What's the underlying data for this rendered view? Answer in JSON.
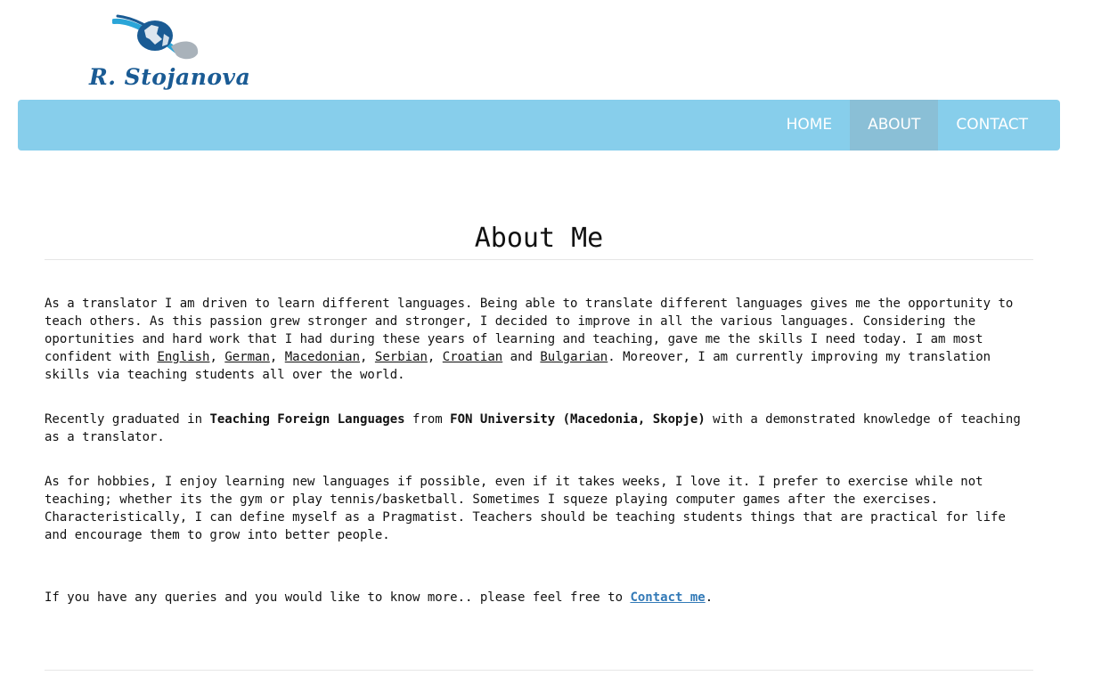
{
  "logo": {
    "text": "R. Stojanova",
    "icon": "globe-swoosh-icon"
  },
  "nav": {
    "items": [
      {
        "label": "HOME"
      },
      {
        "label": "ABOUT"
      },
      {
        "label": "CONTACT"
      }
    ],
    "active": "ABOUT"
  },
  "main": {
    "title": "About Me",
    "p1": {
      "text1": "As a translator I am driven to learn different languages. Being able to translate different languages gives me the opportunity to teach others. As this passion grew stronger and stronger, I decided to improve in all the various languages. Considering the oportunities and hard work that I had during these years of learning and teaching, gave me the skills I need today. I am most confident with ",
      "lang1": "English",
      "sep1": ", ",
      "lang2": "German",
      "sep2": ", ",
      "lang3": "Macedonian",
      "sep3": ", ",
      "lang4": "Serbian",
      "sep4": ", ",
      "lang5": "Croatian",
      "sep5": " and ",
      "lang6": "Bulgarian",
      "text2": ". Moreover, I am currently improving my translation skills via teaching students all over the world."
    },
    "p2": {
      "text1": "Recently graduated in ",
      "bold1": "Teaching Foreign Languages",
      "text2": " from ",
      "bold2": "FON University (Macedonia, Skopje)",
      "text3": " with a demonstrated knowledge of teaching as a translator."
    },
    "p3": {
      "text": "As for hobbies, I enjoy learning new languages if possible, even if it takes weeks, I love it. I prefer to exercise while not teaching; whether its the gym or play tennis/basketball. Sometimes I squeze playing computer games after the exercises. Characteristically, I can define myself as a Pragmatist. Teachers should be teaching students things that are practical for life and encourage them to grow into better people."
    },
    "p4": {
      "text1": "If you have any queries and you would like to know more.. please feel free to ",
      "link": "Contact me",
      "text2": "."
    }
  },
  "colors": {
    "navbar_bg": "#87ceeb",
    "active_nav_bg": "#8abfd6",
    "logo_text": "#1a5b94",
    "link": "#337ab7"
  }
}
